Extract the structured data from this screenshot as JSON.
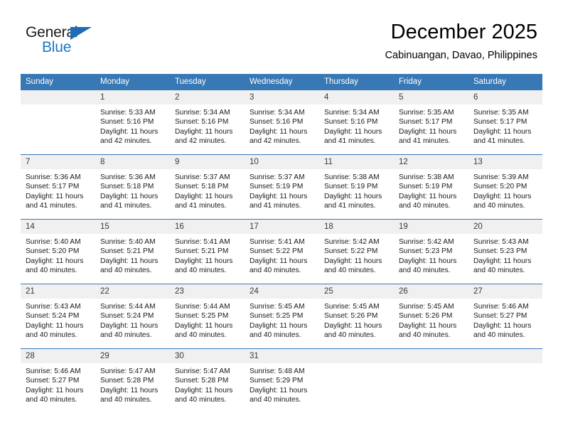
{
  "brand": {
    "name_dark": "General",
    "name_blue": "Blue",
    "accent_blue": "#1878c8",
    "flag_blue": "#1d6cb5"
  },
  "header": {
    "month_title": "December 2025",
    "location": "Cabinuangan, Davao, Philippines"
  },
  "calendar": {
    "header_color": "#3878b4",
    "daynum_bg": "#f0f0f0",
    "weekday_headers": [
      "Sunday",
      "Monday",
      "Tuesday",
      "Wednesday",
      "Thursday",
      "Friday",
      "Saturday"
    ],
    "weeks": [
      [
        {
          "day": "",
          "sunrise": "",
          "sunset": "",
          "daylight1": "",
          "daylight2": ""
        },
        {
          "day": "1",
          "sunrise": "Sunrise: 5:33 AM",
          "sunset": "Sunset: 5:16 PM",
          "daylight1": "Daylight: 11 hours",
          "daylight2": "and 42 minutes."
        },
        {
          "day": "2",
          "sunrise": "Sunrise: 5:34 AM",
          "sunset": "Sunset: 5:16 PM",
          "daylight1": "Daylight: 11 hours",
          "daylight2": "and 42 minutes."
        },
        {
          "day": "3",
          "sunrise": "Sunrise: 5:34 AM",
          "sunset": "Sunset: 5:16 PM",
          "daylight1": "Daylight: 11 hours",
          "daylight2": "and 42 minutes."
        },
        {
          "day": "4",
          "sunrise": "Sunrise: 5:34 AM",
          "sunset": "Sunset: 5:16 PM",
          "daylight1": "Daylight: 11 hours",
          "daylight2": "and 41 minutes."
        },
        {
          "day": "5",
          "sunrise": "Sunrise: 5:35 AM",
          "sunset": "Sunset: 5:17 PM",
          "daylight1": "Daylight: 11 hours",
          "daylight2": "and 41 minutes."
        },
        {
          "day": "6",
          "sunrise": "Sunrise: 5:35 AM",
          "sunset": "Sunset: 5:17 PM",
          "daylight1": "Daylight: 11 hours",
          "daylight2": "and 41 minutes."
        }
      ],
      [
        {
          "day": "7",
          "sunrise": "Sunrise: 5:36 AM",
          "sunset": "Sunset: 5:17 PM",
          "daylight1": "Daylight: 11 hours",
          "daylight2": "and 41 minutes."
        },
        {
          "day": "8",
          "sunrise": "Sunrise: 5:36 AM",
          "sunset": "Sunset: 5:18 PM",
          "daylight1": "Daylight: 11 hours",
          "daylight2": "and 41 minutes."
        },
        {
          "day": "9",
          "sunrise": "Sunrise: 5:37 AM",
          "sunset": "Sunset: 5:18 PM",
          "daylight1": "Daylight: 11 hours",
          "daylight2": "and 41 minutes."
        },
        {
          "day": "10",
          "sunrise": "Sunrise: 5:37 AM",
          "sunset": "Sunset: 5:19 PM",
          "daylight1": "Daylight: 11 hours",
          "daylight2": "and 41 minutes."
        },
        {
          "day": "11",
          "sunrise": "Sunrise: 5:38 AM",
          "sunset": "Sunset: 5:19 PM",
          "daylight1": "Daylight: 11 hours",
          "daylight2": "and 41 minutes."
        },
        {
          "day": "12",
          "sunrise": "Sunrise: 5:38 AM",
          "sunset": "Sunset: 5:19 PM",
          "daylight1": "Daylight: 11 hours",
          "daylight2": "and 40 minutes."
        },
        {
          "day": "13",
          "sunrise": "Sunrise: 5:39 AM",
          "sunset": "Sunset: 5:20 PM",
          "daylight1": "Daylight: 11 hours",
          "daylight2": "and 40 minutes."
        }
      ],
      [
        {
          "day": "14",
          "sunrise": "Sunrise: 5:40 AM",
          "sunset": "Sunset: 5:20 PM",
          "daylight1": "Daylight: 11 hours",
          "daylight2": "and 40 minutes."
        },
        {
          "day": "15",
          "sunrise": "Sunrise: 5:40 AM",
          "sunset": "Sunset: 5:21 PM",
          "daylight1": "Daylight: 11 hours",
          "daylight2": "and 40 minutes."
        },
        {
          "day": "16",
          "sunrise": "Sunrise: 5:41 AM",
          "sunset": "Sunset: 5:21 PM",
          "daylight1": "Daylight: 11 hours",
          "daylight2": "and 40 minutes."
        },
        {
          "day": "17",
          "sunrise": "Sunrise: 5:41 AM",
          "sunset": "Sunset: 5:22 PM",
          "daylight1": "Daylight: 11 hours",
          "daylight2": "and 40 minutes."
        },
        {
          "day": "18",
          "sunrise": "Sunrise: 5:42 AM",
          "sunset": "Sunset: 5:22 PM",
          "daylight1": "Daylight: 11 hours",
          "daylight2": "and 40 minutes."
        },
        {
          "day": "19",
          "sunrise": "Sunrise: 5:42 AM",
          "sunset": "Sunset: 5:23 PM",
          "daylight1": "Daylight: 11 hours",
          "daylight2": "and 40 minutes."
        },
        {
          "day": "20",
          "sunrise": "Sunrise: 5:43 AM",
          "sunset": "Sunset: 5:23 PM",
          "daylight1": "Daylight: 11 hours",
          "daylight2": "and 40 minutes."
        }
      ],
      [
        {
          "day": "21",
          "sunrise": "Sunrise: 5:43 AM",
          "sunset": "Sunset: 5:24 PM",
          "daylight1": "Daylight: 11 hours",
          "daylight2": "and 40 minutes."
        },
        {
          "day": "22",
          "sunrise": "Sunrise: 5:44 AM",
          "sunset": "Sunset: 5:24 PM",
          "daylight1": "Daylight: 11 hours",
          "daylight2": "and 40 minutes."
        },
        {
          "day": "23",
          "sunrise": "Sunrise: 5:44 AM",
          "sunset": "Sunset: 5:25 PM",
          "daylight1": "Daylight: 11 hours",
          "daylight2": "and 40 minutes."
        },
        {
          "day": "24",
          "sunrise": "Sunrise: 5:45 AM",
          "sunset": "Sunset: 5:25 PM",
          "daylight1": "Daylight: 11 hours",
          "daylight2": "and 40 minutes."
        },
        {
          "day": "25",
          "sunrise": "Sunrise: 5:45 AM",
          "sunset": "Sunset: 5:26 PM",
          "daylight1": "Daylight: 11 hours",
          "daylight2": "and 40 minutes."
        },
        {
          "day": "26",
          "sunrise": "Sunrise: 5:45 AM",
          "sunset": "Sunset: 5:26 PM",
          "daylight1": "Daylight: 11 hours",
          "daylight2": "and 40 minutes."
        },
        {
          "day": "27",
          "sunrise": "Sunrise: 5:46 AM",
          "sunset": "Sunset: 5:27 PM",
          "daylight1": "Daylight: 11 hours",
          "daylight2": "and 40 minutes."
        }
      ],
      [
        {
          "day": "28",
          "sunrise": "Sunrise: 5:46 AM",
          "sunset": "Sunset: 5:27 PM",
          "daylight1": "Daylight: 11 hours",
          "daylight2": "and 40 minutes."
        },
        {
          "day": "29",
          "sunrise": "Sunrise: 5:47 AM",
          "sunset": "Sunset: 5:28 PM",
          "daylight1": "Daylight: 11 hours",
          "daylight2": "and 40 minutes."
        },
        {
          "day": "30",
          "sunrise": "Sunrise: 5:47 AM",
          "sunset": "Sunset: 5:28 PM",
          "daylight1": "Daylight: 11 hours",
          "daylight2": "and 40 minutes."
        },
        {
          "day": "31",
          "sunrise": "Sunrise: 5:48 AM",
          "sunset": "Sunset: 5:29 PM",
          "daylight1": "Daylight: 11 hours",
          "daylight2": "and 40 minutes."
        },
        {
          "day": "",
          "sunrise": "",
          "sunset": "",
          "daylight1": "",
          "daylight2": ""
        },
        {
          "day": "",
          "sunrise": "",
          "sunset": "",
          "daylight1": "",
          "daylight2": ""
        },
        {
          "day": "",
          "sunrise": "",
          "sunset": "",
          "daylight1": "",
          "daylight2": ""
        }
      ]
    ]
  }
}
